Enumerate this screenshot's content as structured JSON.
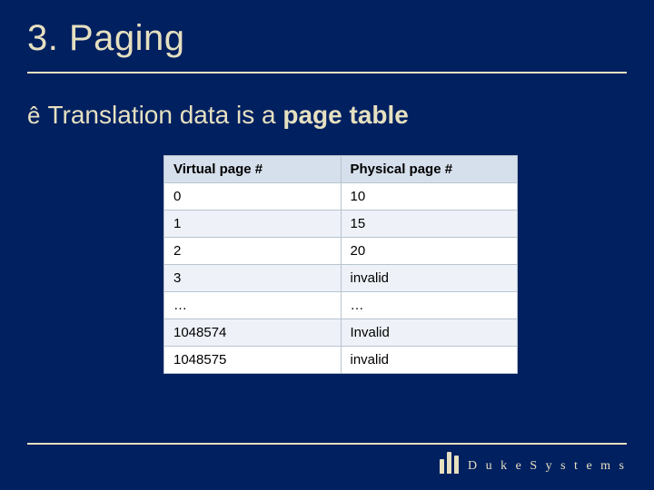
{
  "title": "3. Paging",
  "bullet": {
    "glyph": "ê",
    "text_prefix": "Translation data is a ",
    "text_bold": "page table"
  },
  "table": {
    "headers": [
      "Virtual page #",
      "Physical page #"
    ],
    "rows": [
      {
        "c0": "0",
        "c1": "10"
      },
      {
        "c0": "1",
        "c1": "15"
      },
      {
        "c0": "2",
        "c1": "20"
      },
      {
        "c0": "3",
        "c1": "invalid"
      },
      {
        "c0": "…",
        "c1": "…"
      },
      {
        "c0": "1048574",
        "c1": "Invalid"
      },
      {
        "c0": "1048575",
        "c1": "invalid"
      }
    ]
  },
  "footer": {
    "brand": "D u k e   S y s t e m s"
  }
}
